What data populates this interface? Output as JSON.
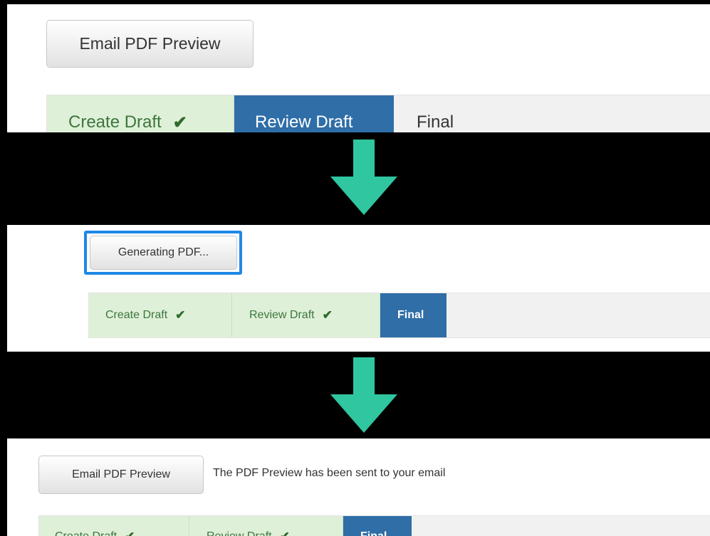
{
  "accent_color": "#2f6ea7",
  "done_color": "#dff0d8",
  "arrow_color": "#2fc6a0",
  "steps_labels": [
    "Create Draft",
    "Review Draft",
    "Final"
  ],
  "check_glyph": "✔",
  "state1": {
    "button_label": "Email PDF Preview",
    "steps": [
      {
        "label": "Create Draft",
        "status": "done"
      },
      {
        "label": "Review Draft",
        "status": "active"
      },
      {
        "label": "Final",
        "status": "pending"
      }
    ]
  },
  "state2": {
    "button_label": "Generating PDF...",
    "steps": [
      {
        "label": "Create Draft",
        "status": "done"
      },
      {
        "label": "Review Draft",
        "status": "done"
      },
      {
        "label": "Final",
        "status": "active"
      }
    ]
  },
  "state3": {
    "button_label": "Email PDF Preview",
    "message": "The PDF Preview has been sent to your email",
    "steps": [
      {
        "label": "Create Draft",
        "status": "done"
      },
      {
        "label": "Review Draft",
        "status": "done"
      },
      {
        "label": "Final",
        "status": "active"
      }
    ]
  }
}
